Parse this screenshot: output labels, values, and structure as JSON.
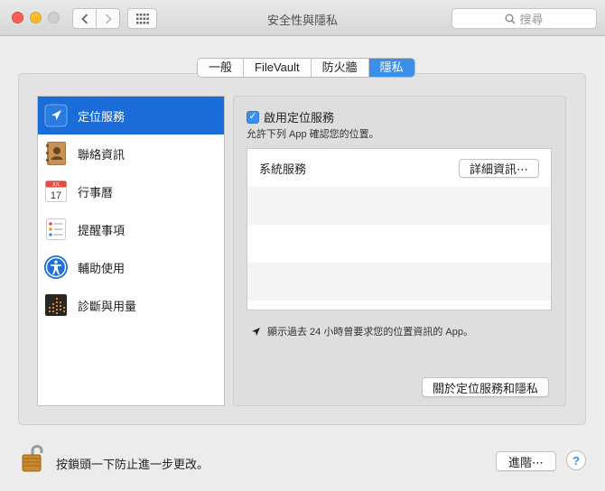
{
  "window": {
    "title": "安全性與隱私"
  },
  "toolbar": {
    "search_placeholder": "搜尋"
  },
  "tabs": [
    {
      "label": "一般",
      "active": false
    },
    {
      "label": "FileVault",
      "active": false
    },
    {
      "label": "防火牆",
      "active": false
    },
    {
      "label": "隱私",
      "active": true
    }
  ],
  "sidebar": {
    "items": [
      {
        "label": "定位服務",
        "icon": "location-arrow-icon",
        "selected": true
      },
      {
        "label": "聯絡資訊",
        "icon": "contacts-book-icon",
        "selected": false
      },
      {
        "label": "行事曆",
        "icon": "calendar-icon",
        "selected": false
      },
      {
        "label": "提醒事項",
        "icon": "reminders-icon",
        "selected": false
      },
      {
        "label": "輔助使用",
        "icon": "accessibility-icon",
        "selected": false
      },
      {
        "label": "診斷與用量",
        "icon": "diagnostics-icon",
        "selected": false
      }
    ]
  },
  "calendar_icon": {
    "month": "JUL",
    "day": "17"
  },
  "location": {
    "enable_label": "啟用定位服務",
    "enabled": true,
    "subtitle": "允許下列 App 確認您的位置。",
    "apps": [
      {
        "name": "系統服務",
        "button": "詳細資訊⋯"
      }
    ],
    "hint": "顯示過去 24 小時曾要求您的位置資訊的 App。",
    "about_button": "關於定位服務和隱私"
  },
  "footer": {
    "lock_text": "按鎖頭一下防止進一步更改。",
    "advanced_button": "進階⋯",
    "help_label": "?"
  },
  "colors": {
    "accent": "#3b8fe8",
    "selection": "#1a6cd8"
  }
}
